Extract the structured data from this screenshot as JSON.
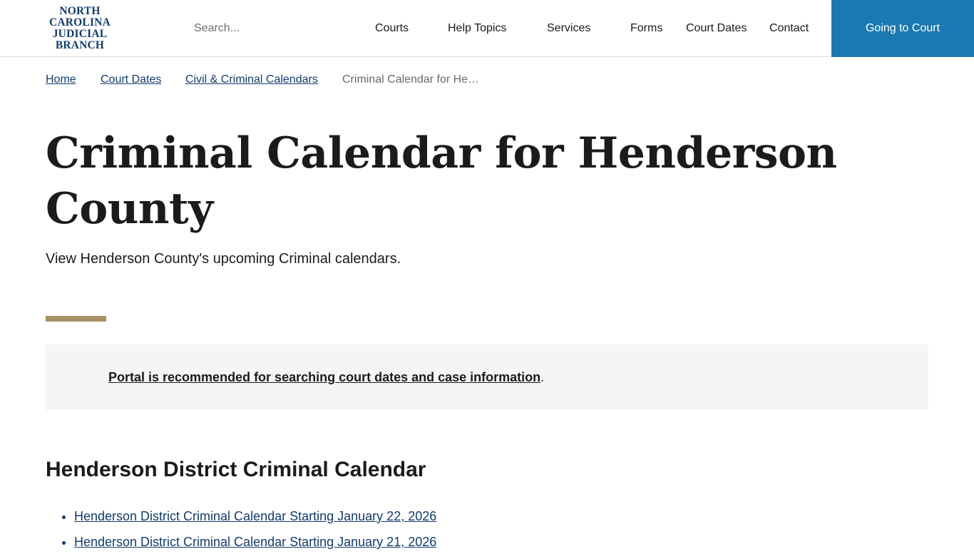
{
  "header": {
    "logo_lines": [
      "NORTH",
      "CAROLINA",
      "JUDICIAL",
      "BRANCH"
    ],
    "search_placeholder": "Search...",
    "nav": [
      {
        "label": "Courts"
      },
      {
        "label": "Help Topics"
      },
      {
        "label": "Services"
      },
      {
        "label": "Forms"
      },
      {
        "label": "Court Dates"
      },
      {
        "label": "Contact"
      }
    ],
    "cta_label": "Going to Court"
  },
  "breadcrumb": {
    "items": [
      "Home",
      "Court Dates",
      "Civil & Criminal Calendars"
    ],
    "current": "Criminal Calendar for He…"
  },
  "page": {
    "title": "Criminal Calendar for Henderson County",
    "subtitle": "View Henderson County's upcoming Criminal calendars."
  },
  "notice": {
    "link_text": "Portal is recommended for searching court dates and case information",
    "trailing": "."
  },
  "section": {
    "title": "Henderson District Criminal Calendar",
    "items": [
      "Henderson District Criminal Calendar Starting January 22, 2026",
      "Henderson District Criminal Calendar Starting January 21, 2026"
    ]
  },
  "colors": {
    "brand_navy": "#123b6d",
    "cta_blue": "#1a79b0",
    "gold_accent": "#a89166",
    "notice_bg": "#f5f5f5"
  }
}
